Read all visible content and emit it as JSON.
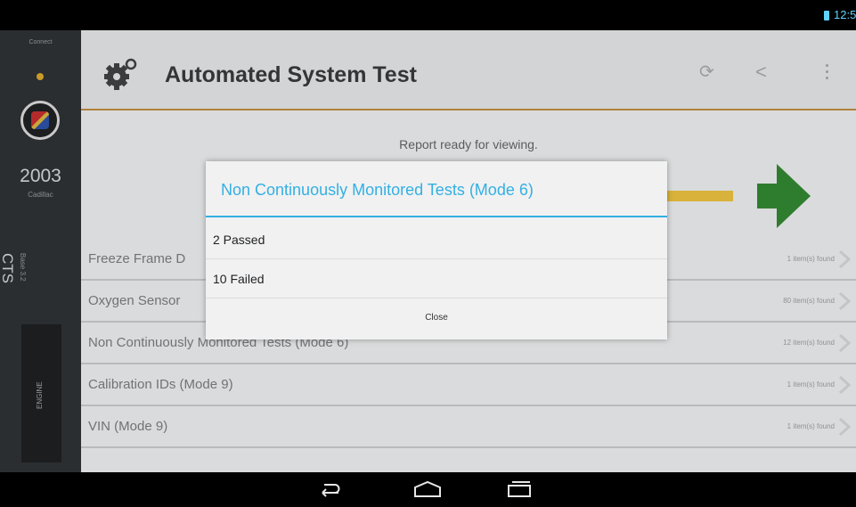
{
  "status_bar": {
    "time": "12:5"
  },
  "vehicle_panel": {
    "top_label": "Connect",
    "year": "2003",
    "make": "Cadillac",
    "model": "CTS",
    "trim": "Base 3.2",
    "module": "ENGINE"
  },
  "header": {
    "title": "Automated System Test",
    "icons": [
      "gear-icon",
      "refresh-icon",
      "share-icon",
      "overflow-menu-icon"
    ]
  },
  "report": {
    "message": "Report ready for viewing.",
    "accent_color": "#d8b23a",
    "arrow_color": "#2e7d2e"
  },
  "results": [
    {
      "name": "Freeze Frame D",
      "count": "1 item(s) found"
    },
    {
      "name": "Oxygen Sensor",
      "count": "80 item(s) found"
    },
    {
      "name": "Non Continuously Monitored Tests (Mode 6)",
      "count": "12 item(s) found"
    },
    {
      "name": "Calibration IDs (Mode 9)",
      "count": "1 item(s) found"
    },
    {
      "name": "VIN (Mode 9)",
      "count": "1 item(s) found"
    }
  ],
  "dialog": {
    "title": "Non Continuously Monitored Tests (Mode 6)",
    "options": [
      "2 Passed",
      "10 Failed"
    ],
    "close_label": "Close",
    "accent_color": "#33b0e3"
  },
  "nav_bar": {
    "icons": [
      "back-icon",
      "home-icon",
      "recent-apps-icon"
    ]
  }
}
